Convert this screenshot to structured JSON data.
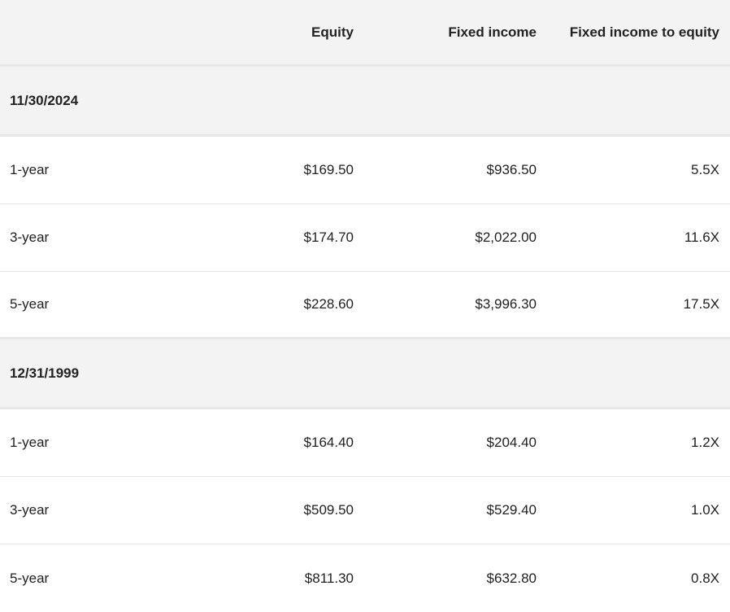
{
  "table": {
    "headers": {
      "label": "",
      "equity": "Equity",
      "fixed_income": "Fixed income",
      "ratio": "Fixed income to equity"
    },
    "groups": [
      {
        "date": "11/30/2024",
        "rows": [
          {
            "period": "1-year",
            "equity": "$169.50",
            "fixed_income": "$936.50",
            "ratio": "5.5X"
          },
          {
            "period": "3-year",
            "equity": "$174.70",
            "fixed_income": "$2,022.00",
            "ratio": "11.6X"
          },
          {
            "period": "5-year",
            "equity": "$228.60",
            "fixed_income": "$3,996.30",
            "ratio": "17.5X"
          }
        ]
      },
      {
        "date": "12/31/1999",
        "rows": [
          {
            "period": "1-year",
            "equity": "$164.40",
            "fixed_income": "$204.40",
            "ratio": "1.2X"
          },
          {
            "period": "3-year",
            "equity": "$509.50",
            "fixed_income": "$529.40",
            "ratio": "1.0X"
          },
          {
            "period": "5-year",
            "equity": "$811.30",
            "fixed_income": "$632.80",
            "ratio": "0.8X"
          }
        ]
      }
    ]
  }
}
